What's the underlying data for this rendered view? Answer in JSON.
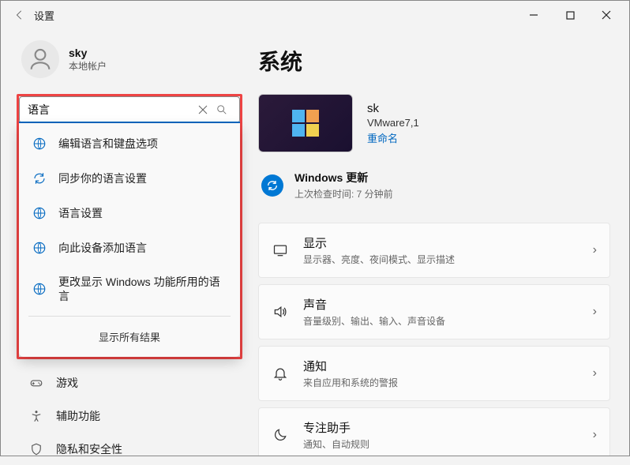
{
  "window": {
    "title": "设置"
  },
  "profile": {
    "name": "sky",
    "account_type": "本地帐户"
  },
  "search": {
    "value": "语言"
  },
  "suggestions": [
    {
      "label": "编辑语言和键盘选项"
    },
    {
      "label": "同步你的语言设置"
    },
    {
      "label": "语言设置"
    },
    {
      "label": "向此设备添加语言"
    },
    {
      "label": "更改显示 Windows 功能所用的语言"
    }
  ],
  "show_all": "显示所有结果",
  "nav": {
    "gaming": "游戏",
    "accessibility": "辅助功能",
    "privacy": "隐私和安全性"
  },
  "page": {
    "title": "系统"
  },
  "system": {
    "pc_name": "sk",
    "model": "VMware7,1",
    "rename": "重命名"
  },
  "update": {
    "title": "Windows 更新",
    "checked": "上次检查时间: 7 分钟前"
  },
  "cards": [
    {
      "title": "显示",
      "sub": "显示器、亮度、夜间模式、显示描述"
    },
    {
      "title": "声音",
      "sub": "音量级别、输出、输入、声音设备"
    },
    {
      "title": "通知",
      "sub": "来自应用和系统的警报"
    },
    {
      "title": "专注助手",
      "sub": "通知、自动规则"
    }
  ]
}
